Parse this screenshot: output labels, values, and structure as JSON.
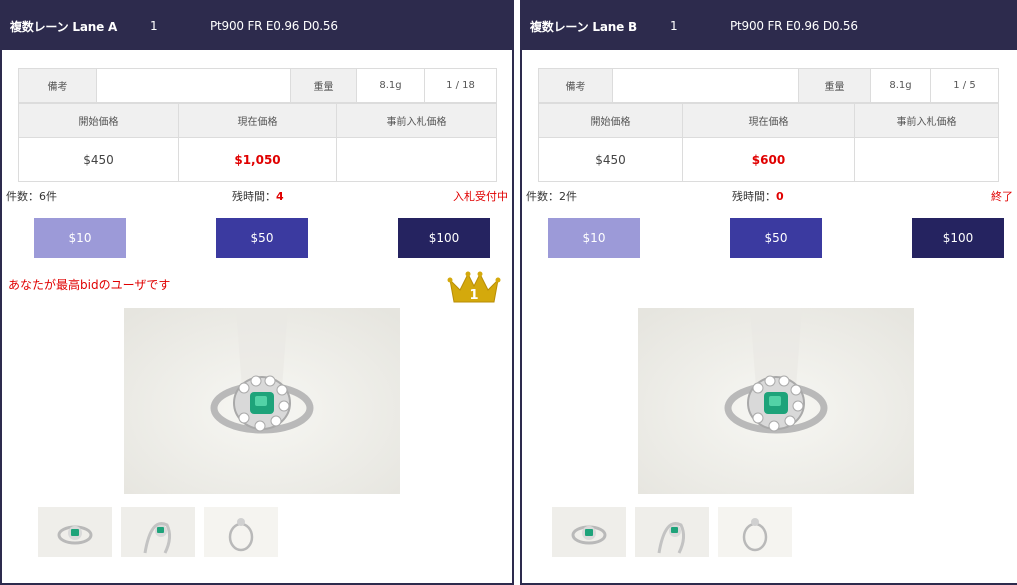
{
  "lanes": [
    {
      "header": {
        "title": "複数レーン Lane A",
        "number": "1",
        "item": "Pt900 FR E0.96 D0.56"
      },
      "info": {
        "remarks_label": "備考",
        "remarks_value": "",
        "weight_label": "重量",
        "weight_value": "8.1g",
        "page": "1 / 18",
        "start_price_label": "開始価格",
        "current_price_label": "現在価格",
        "prebid_label": "事前入札価格",
        "start_price": "$450",
        "current_price": "$1,050",
        "prebid_price": ""
      },
      "status": {
        "count": "件数：6件",
        "remaining_label": "残時間：",
        "remaining_value": "4",
        "state": "入札受付中"
      },
      "buttons": {
        "b10": "$10",
        "b50": "$50",
        "b100": "$100"
      },
      "winner_message": "あなたが最高bidのユーザです",
      "crown_rank": "1"
    },
    {
      "header": {
        "title": "複数レーン Lane B",
        "number": "1",
        "item": "Pt900 FR E0.96 D0.56"
      },
      "info": {
        "remarks_label": "備考",
        "remarks_value": "",
        "weight_label": "重量",
        "weight_value": "8.1g",
        "page": "1 / 5",
        "start_price_label": "開始価格",
        "current_price_label": "現在価格",
        "prebid_label": "事前入札価格",
        "start_price": "$450",
        "current_price": "$600",
        "prebid_price": ""
      },
      "status": {
        "count": "件数：2件",
        "remaining_label": "残時間：",
        "remaining_value": "0",
        "state": "終了"
      },
      "buttons": {
        "b10": "$10",
        "b50": "$50",
        "b100": "$100"
      }
    }
  ],
  "colors": {
    "header_bg": "#2d2b4d",
    "button_10": "#9c9ad8",
    "button_50": "#3b3aa0",
    "button_100": "#252360",
    "alert_red": "#e00000",
    "crown_gold": "#d4a90c"
  }
}
